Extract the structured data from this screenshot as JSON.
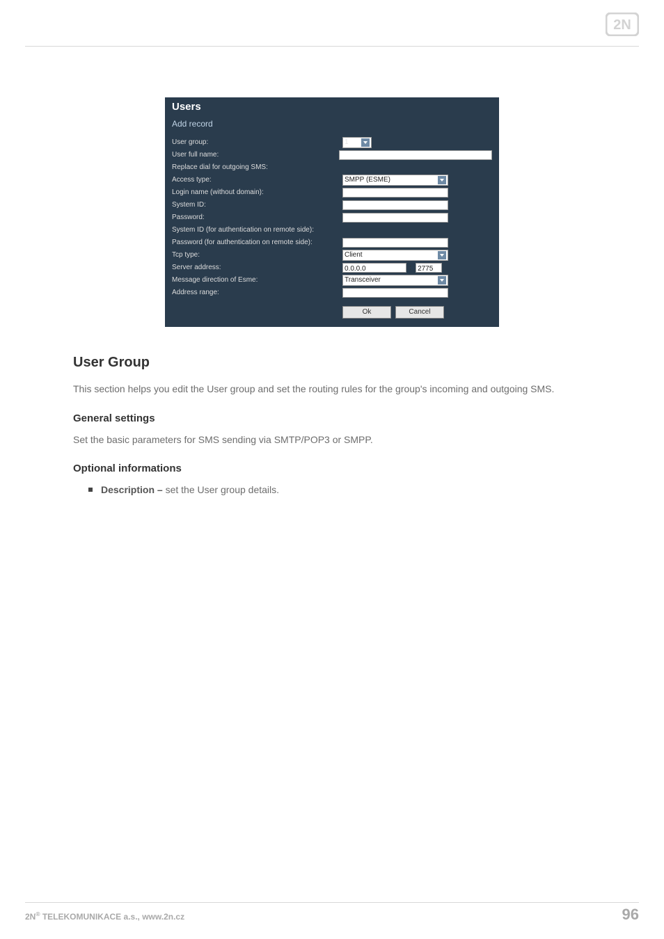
{
  "logo_alt": "2N",
  "panel": {
    "title": "Users",
    "subtitle": "Add record",
    "labels": {
      "user_group": "User group:",
      "user_full_name": "User full name:",
      "replace_dial": "Replace dial for outgoing SMS:",
      "access_type": "Access type:",
      "login_name": "Login name (without domain):",
      "system_id": "System ID:",
      "password": "Password:",
      "system_id_remote": "System ID (for authentication on remote side):",
      "password_remote": "Password (for authentication on remote side):",
      "tcp_type": "Tcp type:",
      "server_address": "Server address:",
      "msg_dir": "Message direction of Esme:",
      "addr_range": "Address range:"
    },
    "values": {
      "user_group": "1",
      "access_type": "SMPP (ESME)",
      "tcp_type": "Client",
      "server_ip": "0.0.0.0",
      "server_port": "2775",
      "msg_dir": "Transceiver"
    },
    "buttons": {
      "ok": "Ok",
      "cancel": "Cancel"
    }
  },
  "section": {
    "heading": "User Group",
    "intro": "This section helps you edit the User group and set the routing rules for the group's incoming and outgoing SMS.",
    "sub1_heading": "General settings",
    "sub1_text": "Set the basic parameters for SMS sending via SMTP/POP3 or SMPP.",
    "sub2_heading": "Optional informations",
    "bullet_strong": "Description –",
    "bullet_rest": " set the User group details."
  },
  "footer": {
    "left_prefix": "2N",
    "left_reg": "®",
    "left_rest": " TELEKOMUNIKACE a.s., www.2n.cz",
    "page_no": "96"
  }
}
